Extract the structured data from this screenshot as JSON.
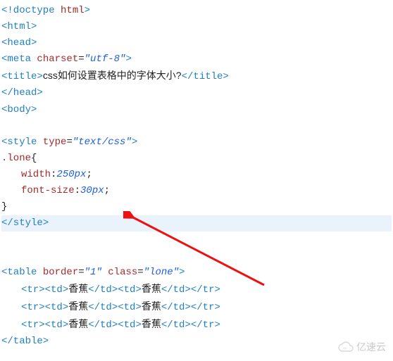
{
  "code": {
    "l01_a": "<!doctype",
    "l01_b": "html",
    "l01_c": ">",
    "l02": "<html>",
    "l03": "<head>",
    "l04_a": "<meta",
    "l04_b": "charset",
    "l04_c": "=",
    "l04_d": "\"utf-8\"",
    "l04_e": ">",
    "l05_a": "<title>",
    "l05_b": "css如何设置表格中的字体大小?",
    "l05_c": "</title>",
    "l06": "</head>",
    "l07": "<body>",
    "blank1": " ",
    "l08_a": "<style",
    "l08_b": "type",
    "l08_c": "=",
    "l08_d": "\"text/css\"",
    "l08_e": ">",
    "l09_a": ".lone",
    "l09_b": "{",
    "l10_a": "width",
    "l10_b": ":",
    "l10_c": "250px",
    "l10_d": ";",
    "l11_a": "font-size",
    "l11_b": ":",
    "l11_c": "30px",
    "l11_d": ";",
    "l12": "}",
    "l13": "</style>",
    "blank2": " ",
    "blank3": " ",
    "l14_a": "<table",
    "l14_b": "border",
    "l14_c": "=",
    "l14_d": "\"1\"",
    "l14_e": "class",
    "l14_f": "=",
    "l14_g": "\"lone\"",
    "l14_h": ">",
    "row_tr_o": "<tr>",
    "row_td_o": "<td>",
    "row_cell": "香蕉",
    "row_td_c": "</td>",
    "row_tr_c": "</tr>",
    "l18": "</table>"
  },
  "watermark": "亿速云"
}
